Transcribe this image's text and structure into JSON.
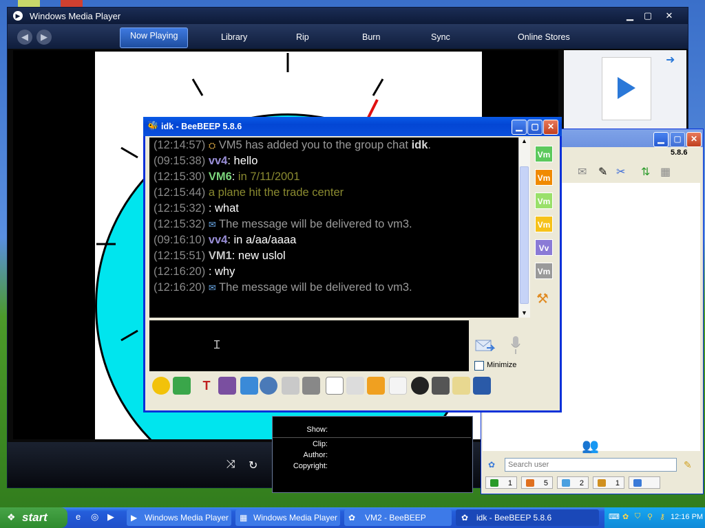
{
  "wmp": {
    "title": "Windows Media Player",
    "tabs": [
      {
        "label": "Now Playing"
      },
      {
        "label": "Library"
      },
      {
        "label": "Rip"
      },
      {
        "label": "Burn"
      },
      {
        "label": "Sync"
      },
      {
        "label": "Online Stores"
      }
    ],
    "meta": {
      "show": "Show:",
      "clip": "Clip:",
      "author": "Author:",
      "copyright": "Copyright:"
    }
  },
  "chat": {
    "title": "idk - BeeBEEP 5.8.6",
    "messages": [
      {
        "ts": "(12:14:57)",
        "icon": "group-icon",
        "sender": "",
        "text": " VM5 has added you to the group chat ",
        "bold_tail": "idk",
        "tail": ".",
        "color": "#9a9a9a"
      },
      {
        "ts": "(09:15:38)",
        "sender": "vv4",
        "sender_color": "#9a8fd8",
        "text": ": hello",
        "color": "#ffffff"
      },
      {
        "ts": "(12:15:30)",
        "sender": "VM6",
        "sender_color": "#7cd67c",
        "text": ": ",
        "extra": "in 7/11/2001",
        "extra_color": "#8a8a30",
        "color": "#ffffff"
      },
      {
        "ts": "(12:15:44)",
        "sender": "",
        "text": "    a plane hit the trade center",
        "color": "#8a8a30"
      },
      {
        "ts": "(12:15:32)",
        "sender": "",
        "text": "       : what",
        "color": "#ffffff"
      },
      {
        "ts": "(12:15:32)",
        "icon": "envelope-icon",
        "sender": "",
        "text": " The message will be delivered to vm3.",
        "color": "#9a9a9a"
      },
      {
        "ts": "(09:16:10)",
        "sender": "vv4",
        "sender_color": "#9a8fd8",
        "text": ": in a/aa/aaaa",
        "color": "#ffffff"
      },
      {
        "ts": "(12:15:51)",
        "sender": "VM1",
        "sender_color": "#c8c8c8",
        "text": ": new uslol",
        "color": "#ffffff"
      },
      {
        "ts": "(12:16:20)",
        "sender": "",
        "text": "       : why",
        "color": "#ffffff"
      },
      {
        "ts": "(12:16:20)",
        "icon": "envelope-icon",
        "sender": "",
        "text": " The message will be delivered to vm3.",
        "color": "#9a9a9a"
      }
    ],
    "users": [
      {
        "label": "Vm",
        "bg": "#5cc95c",
        "fg": "#fff"
      },
      {
        "label": "Vm",
        "bg": "#f08a00",
        "fg": "#fff"
      },
      {
        "label": "Vm",
        "bg": "#9ae06a",
        "fg": "#fff"
      },
      {
        "label": "Vm",
        "bg": "#f6c21a",
        "fg": "#fff"
      },
      {
        "label": "Vv",
        "bg": "#8a7ad6",
        "fg": "#fff"
      },
      {
        "label": "Vm",
        "bg": "#9a9a9a",
        "fg": "#fff"
      }
    ],
    "minimize_label": "Minimize"
  },
  "beebeep_main": {
    "version": "5.8.6",
    "search_placeholder": "Search user",
    "tabs": [
      {
        "count": "1",
        "color": "#2a9a2a"
      },
      {
        "count": "5",
        "color": "#e07020"
      },
      {
        "count": "2",
        "color": "#4aa0e0"
      },
      {
        "count": "1",
        "color": "#d09020"
      },
      {
        "count": "",
        "color": "#3a7ad8"
      }
    ]
  },
  "taskbar": {
    "start": "start",
    "items": [
      {
        "label": "Windows Media Player"
      },
      {
        "label": "Windows Media Player"
      },
      {
        "label": "VM2 - BeeBEEP"
      },
      {
        "label": "idk - BeeBEEP 5.8.6"
      }
    ],
    "clock": "12:16 PM"
  }
}
